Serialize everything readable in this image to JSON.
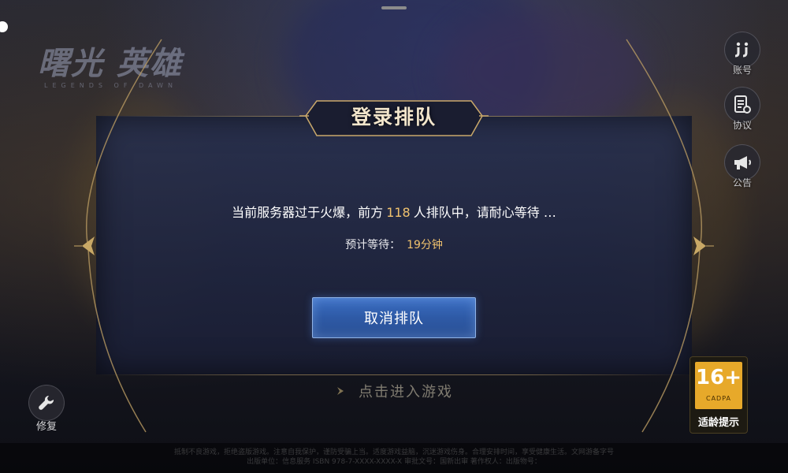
{
  "logo": {
    "title": "曙光 英雄",
    "subtitle": "LEGENDS OF DAWN"
  },
  "side_menu": [
    {
      "id": "account",
      "label": "账号",
      "icon": "jj-account-icon"
    },
    {
      "id": "agreement",
      "label": "协议",
      "icon": "document-settings-icon"
    },
    {
      "id": "announcement",
      "label": "公告",
      "icon": "megaphone-icon"
    }
  ],
  "dialog": {
    "title": "登录排队",
    "message_prefix": "当前服务器过于火爆，前方",
    "queue_count": "118",
    "message_suffix": "人排队中，请耐心等待 …",
    "wait_label": "预计等待：",
    "wait_value": "19分钟",
    "cancel_label": "取消排队"
  },
  "enter_game": {
    "label": "点击进入游戏"
  },
  "repair": {
    "label": "修复",
    "icon": "wrench-icon"
  },
  "age_rating": {
    "number": "16+",
    "org": "CADPA",
    "label": "适龄提示"
  },
  "footer": {
    "line1": "抵制不良游戏，拒绝盗版游戏。注意自我保护，谨防受骗上当。适度游戏益脑，沉迷游戏伤身。合理安排时间，享受健康生活。文网游备字号 ",
    "line2": "出版单位：信息服务 ISBN 978-7-XXXX-XXXX-X 审批文号：国新出审 著作权人：出版物号："
  },
  "colors": {
    "accent_gold": "#f0c26e",
    "button_blue": "#2e5aa6",
    "title_cream": "#f3e6cc",
    "age_orange": "#e7a92a"
  }
}
